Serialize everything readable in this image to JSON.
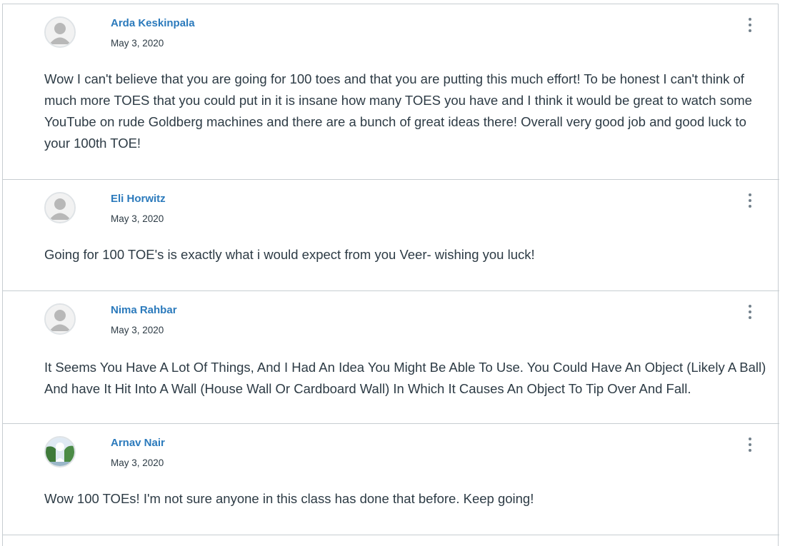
{
  "entries": [
    {
      "author": "Arda Keskinpala",
      "date": "May 3, 2020",
      "avatar_icon": "default-person-icon",
      "message": "Wow I can't believe that you are going for 100 toes and that you are putting this much effort! To be honest I can't think of much more TOES that you could put in it is insane how many TOES you have and I think it would be great to watch some YouTube on rude Goldberg machines and there are a bunch of great ideas there! Overall very good job and good luck to your 100th TOE!"
    },
    {
      "author": "Eli Horwitz",
      "date": "May 3, 2020",
      "avatar_icon": "default-person-icon",
      "message": "Going for 100 TOE's is exactly what i would expect from you Veer- wishing you luck!"
    },
    {
      "author": "Nima Rahbar",
      "date": "May 3, 2020",
      "avatar_icon": "default-person-icon",
      "message": "It Seems You Have A Lot Of Things, And I Had An Idea You Might Be Able To Use. You Could Have An Object (Likely A Ball) And have It Hit Into A Wall (House Wall Or Cardboard Wall) In Which It Causes An Object To Tip Over And Fall."
    },
    {
      "author": "Arnav Nair",
      "date": "May 3, 2020",
      "avatar_icon": "photo-avatar",
      "message": "Wow 100 TOEs! I'm not sure anyone in this class has done that before. Keep going!"
    }
  ],
  "colors": {
    "author_link": "#2b7abc",
    "text": "#2d3b45",
    "divider": "#c7cdd1",
    "kebab": "#73818c"
  }
}
